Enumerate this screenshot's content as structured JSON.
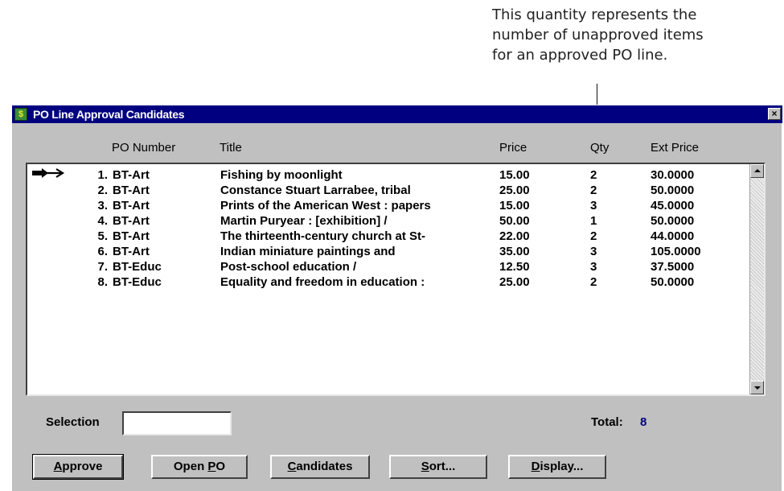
{
  "callout": {
    "lines": [
      "This quantity represents the",
      "number of unapproved items",
      "for an approved PO line."
    ]
  },
  "window": {
    "title": "PO Line Approval Candidates",
    "app_icon_glyph": "$",
    "close_glyph": "×"
  },
  "columns": {
    "po_number": "PO Number",
    "title": "Title",
    "price": "Price",
    "qty": "Qty",
    "ext_price": "Ext Price"
  },
  "pointer_icon": "double-arrow-right",
  "rows": [
    {
      "num": "1.",
      "po": "BT-Art",
      "title": "Fishing by moonlight",
      "price": "15.00",
      "qty": "2",
      "ext": "30.0000"
    },
    {
      "num": "2.",
      "po": "BT-Art",
      "title": "Constance Stuart Larrabee, tribal",
      "price": "25.00",
      "qty": "2",
      "ext": "50.0000"
    },
    {
      "num": "3.",
      "po": "BT-Art",
      "title": "Prints of the American West : papers",
      "price": "15.00",
      "qty": "3",
      "ext": "45.0000"
    },
    {
      "num": "4.",
      "po": "BT-Art",
      "title": "Martin Puryear : [exhibition] /",
      "price": "50.00",
      "qty": "1",
      "ext": "50.0000"
    },
    {
      "num": "5.",
      "po": "BT-Art",
      "title": "The thirteenth-century church at St-",
      "price": "22.00",
      "qty": "2",
      "ext": "44.0000"
    },
    {
      "num": "6.",
      "po": "BT-Art",
      "title": "Indian miniature paintings and",
      "price": "35.00",
      "qty": "3",
      "ext": "105.0000"
    },
    {
      "num": "7.",
      "po": "BT-Educ",
      "title": "Post-school education /",
      "price": "12.50",
      "qty": "3",
      "ext": "37.5000"
    },
    {
      "num": "8.",
      "po": "BT-Educ",
      "title": "Equality and freedom in education :",
      "price": "25.00",
      "qty": "2",
      "ext": "50.0000"
    }
  ],
  "selection": {
    "label": "Selection",
    "value": ""
  },
  "total": {
    "label": "Total:",
    "value": "8"
  },
  "buttons": {
    "approve": {
      "mnemonic": "A",
      "rest": "pprove"
    },
    "open_po": {
      "prefix": "Open ",
      "mnemonic": "P",
      "rest": "O"
    },
    "candidates": {
      "mnemonic": "C",
      "rest": "andidates"
    },
    "sort": {
      "mnemonic": "S",
      "rest": "ort..."
    },
    "display": {
      "mnemonic": "D",
      "rest": "isplay..."
    }
  },
  "colors": {
    "titlebar": "#000080",
    "window_face": "#c0c0c0",
    "total_value": "#000080"
  }
}
